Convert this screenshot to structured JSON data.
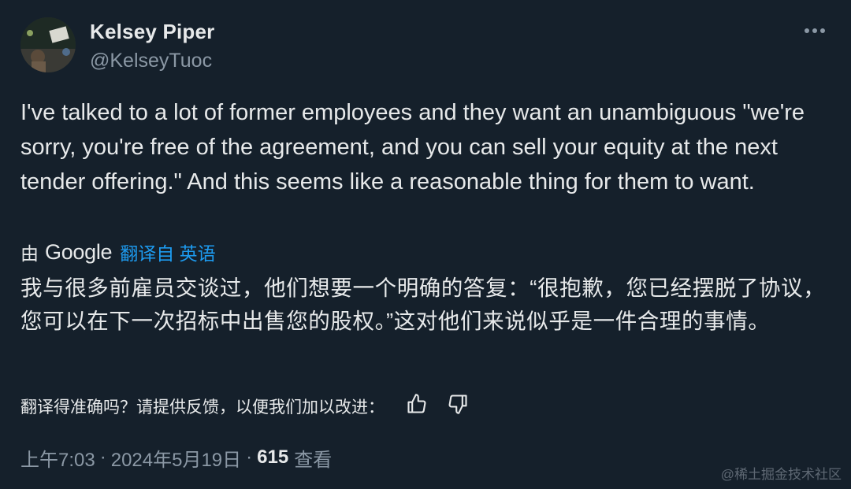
{
  "tweet": {
    "author_name": "Kelsey Piper",
    "author_handle": "@KelseyTuoc",
    "text": "I've talked to a lot of former employees and they want an unambiguous \"we're sorry, you're free of the agreement, and you can sell your equity at the next tender offering.\" And this seems like a reasonable thing for them to want.",
    "more_icon": "ellipsis-icon"
  },
  "translation": {
    "by_label": "由",
    "provider": "Google",
    "translated_from": "翻译自 英语",
    "text": "我与很多前雇员交谈过，他们想要一个明确的答复：“很抱歉，您已经摆脱了协议，您可以在下一次招标中出售您的股权。”这对他们来说似乎是一件合理的事情。"
  },
  "feedback": {
    "question": "翻译得准确吗？请提供反馈，以便我们加以改进：",
    "like_icon": "thumbs-up-icon",
    "dislike_icon": "thumbs-down-icon"
  },
  "meta": {
    "time": "上午7:03",
    "separator": "·",
    "date": "2024年5月19日",
    "views_count": "615",
    "views_label": "查看"
  },
  "watermark": "@稀土掘金技术社区",
  "colors": {
    "background": "#15202b",
    "primary_text": "#e7e9ea",
    "secondary_text": "#8b98a5",
    "link": "#1d9bf0"
  }
}
